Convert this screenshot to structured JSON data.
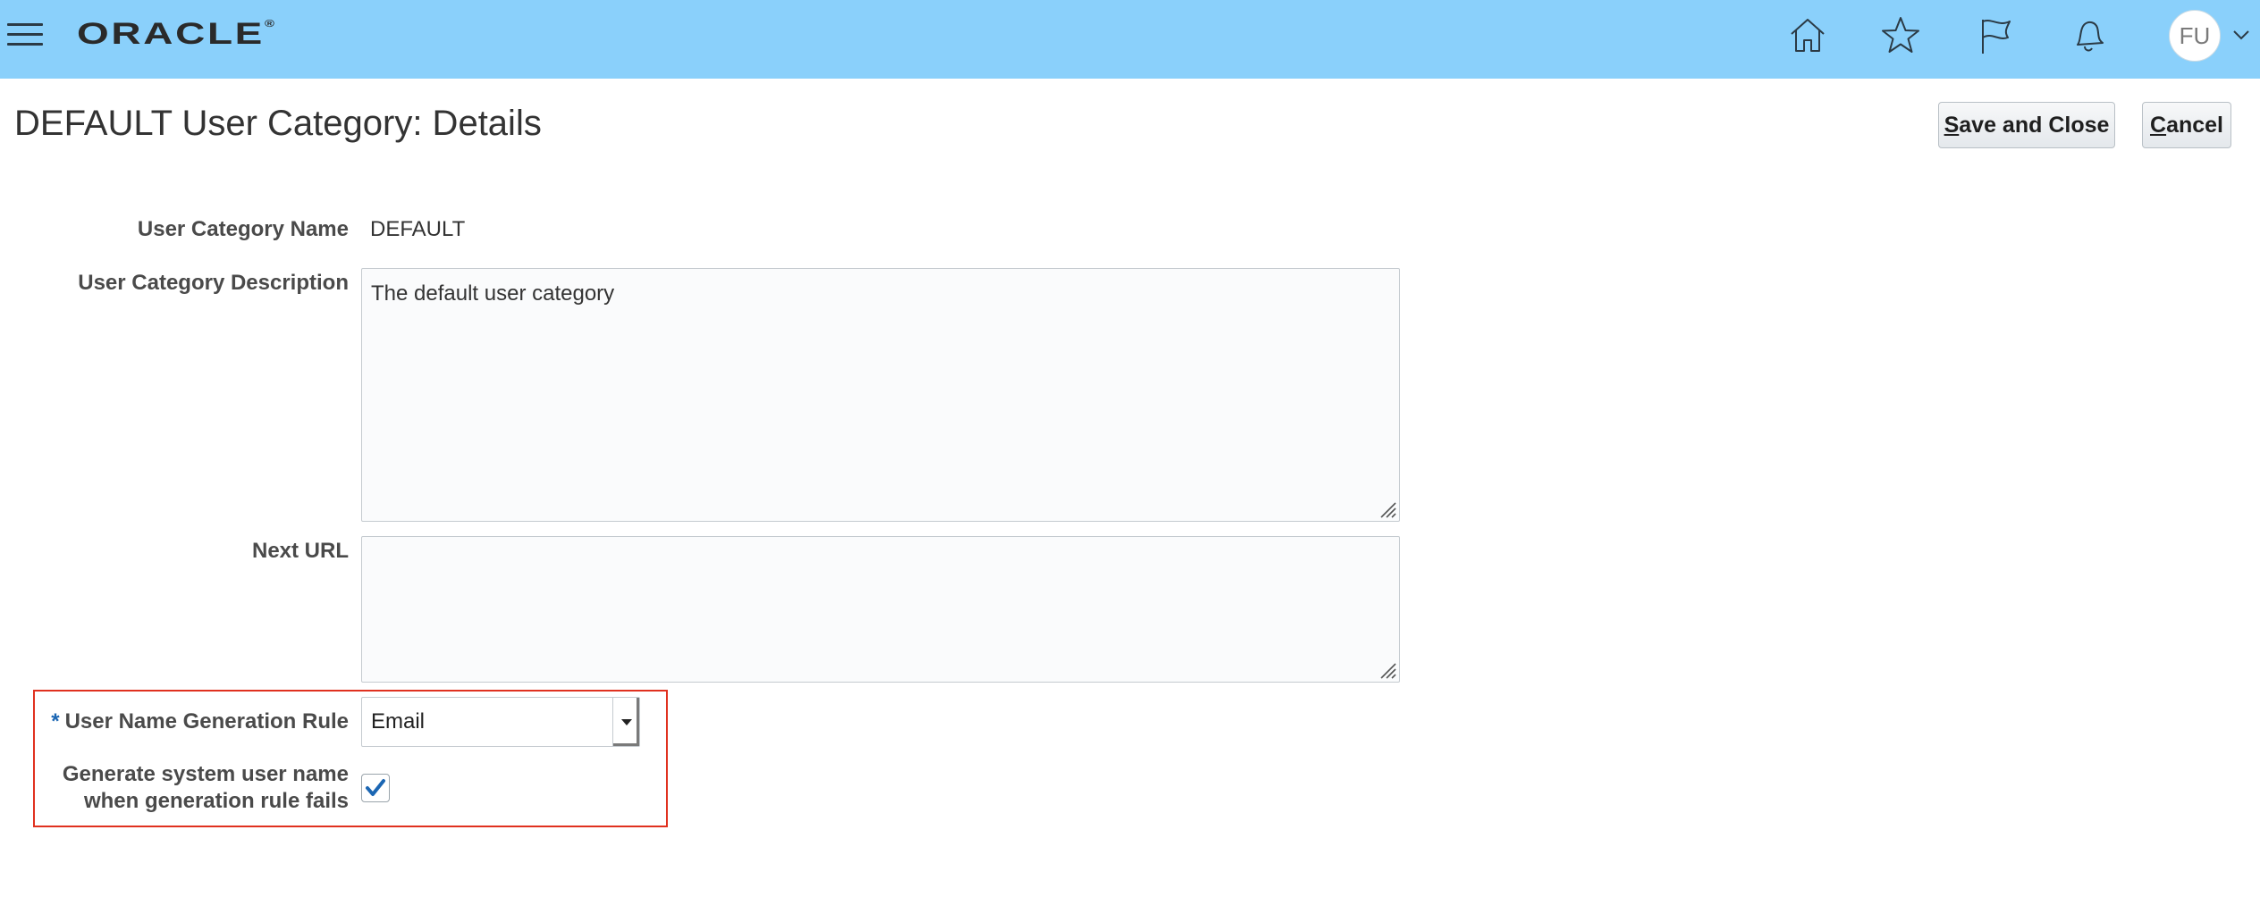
{
  "header": {
    "logo_text": "ORACLE",
    "logo_mark": "®",
    "icons": [
      "menu-icon",
      "home-icon",
      "star-icon",
      "flag-icon",
      "bell-icon"
    ],
    "avatar_initials": "FU",
    "bar_color": "#8ad0fb"
  },
  "page": {
    "title": "DEFAULT User Category: Details",
    "buttons": {
      "save_underline": "S",
      "save_rest": "ave and Close",
      "cancel_underline": "C",
      "cancel_rest": "ancel"
    }
  },
  "form": {
    "name_label": "User Category Name",
    "name_value": "DEFAULT",
    "description_label": "User Category Description",
    "description_value": "The default user category",
    "next_url_label": "Next URL",
    "next_url_value": "",
    "rule_required_marker": "*",
    "rule_label": "User Name Generation Rule",
    "rule_value": "Email",
    "fallback_label_line1": "Generate system user name",
    "fallback_label_line2": "when generation rule fails",
    "fallback_checked": true,
    "highlight_color": "#e0311f",
    "check_color": "#1b66b3"
  }
}
